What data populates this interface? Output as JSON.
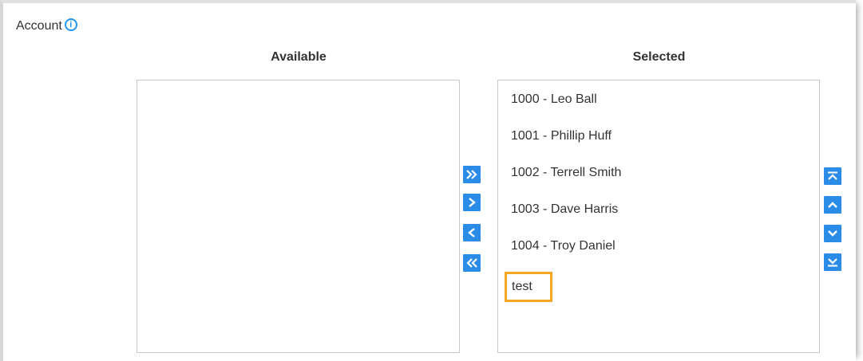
{
  "section": {
    "label": "Account",
    "info_glyph": "i"
  },
  "available": {
    "title": "Available",
    "items": []
  },
  "selected": {
    "title": "Selected",
    "items": [
      "1000 - Leo Ball",
      "1001 - Phillip Huff",
      "1002 - Terrell Smith",
      "1003 - Dave Harris",
      "1004 - Troy Daniel",
      "test"
    ],
    "highlighted_item": "test"
  },
  "transfer_buttons": [
    {
      "icon": "double-chevron-right-icon",
      "name": "add-all-button"
    },
    {
      "icon": "chevron-right-icon",
      "name": "add-selected-button"
    },
    {
      "icon": "chevron-left-icon",
      "name": "remove-selected-button"
    },
    {
      "icon": "double-chevron-left-icon",
      "name": "remove-all-button"
    }
  ],
  "order_buttons": [
    {
      "icon": "move-to-top-icon",
      "name": "move-top-button"
    },
    {
      "icon": "chevron-up-icon",
      "name": "move-up-button"
    },
    {
      "icon": "chevron-down-icon",
      "name": "move-down-button"
    },
    {
      "icon": "move-to-bottom-icon",
      "name": "move-bottom-button"
    }
  ],
  "colors": {
    "accent": "#2b8ce8",
    "info": "#2196f3",
    "highlight": "#f5a623",
    "border": "#c8c8c8"
  }
}
